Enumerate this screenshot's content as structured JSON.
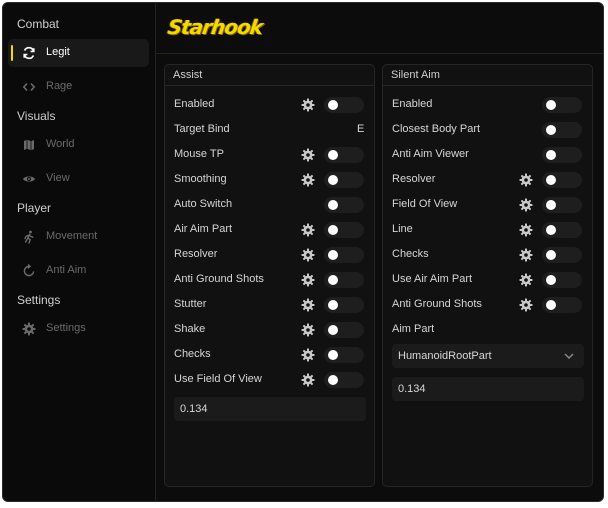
{
  "app": {
    "logo_text": "Starhook",
    "accent": "#f5d800"
  },
  "sidebar": {
    "sections": [
      {
        "title": "Combat"
      },
      {
        "title": "Visuals"
      },
      {
        "title": "Player"
      },
      {
        "title": "Settings"
      }
    ],
    "items": [
      {
        "label": "Legit",
        "icon": "refresh-icon",
        "active": true
      },
      {
        "label": "Rage",
        "icon": "code-icon",
        "active": false
      },
      {
        "label": "World",
        "icon": "map-icon",
        "active": false
      },
      {
        "label": "View",
        "icon": "eye-icon",
        "active": false
      },
      {
        "label": "Movement",
        "icon": "running-person-icon",
        "active": false
      },
      {
        "label": "Anti Aim",
        "icon": "rotate-icon",
        "active": false
      },
      {
        "label": "Settings",
        "icon": "gear-icon",
        "active": false
      }
    ]
  },
  "assist": {
    "title": "Assist",
    "rows": [
      {
        "label": "Enabled",
        "gear": true,
        "toggle": false
      },
      {
        "label": "Target Bind",
        "keybind": "E"
      },
      {
        "label": "Mouse TP",
        "gear": true,
        "toggle": false
      },
      {
        "label": "Smoothing",
        "gear": true,
        "toggle": false
      },
      {
        "label": "Auto Switch",
        "gear": false,
        "toggle": false
      },
      {
        "label": "Air Aim Part",
        "gear": true,
        "toggle": false
      },
      {
        "label": "Resolver",
        "gear": true,
        "toggle": false
      },
      {
        "label": "Anti Ground Shots",
        "gear": true,
        "toggle": false
      },
      {
        "label": "Stutter",
        "gear": true,
        "toggle": false
      },
      {
        "label": "Shake",
        "gear": true,
        "toggle": false
      },
      {
        "label": "Checks",
        "gear": true,
        "toggle": false
      },
      {
        "label": "Use Field Of View",
        "gear": true,
        "toggle": false
      }
    ],
    "value_field": "0.134"
  },
  "silent_aim": {
    "title": "Silent Aim",
    "rows": [
      {
        "label": "Enabled",
        "gear": false,
        "toggle": false
      },
      {
        "label": "Closest Body Part",
        "gear": false,
        "toggle": false
      },
      {
        "label": "Anti Aim Viewer",
        "gear": false,
        "toggle": false
      },
      {
        "label": "Resolver",
        "gear": true,
        "toggle": false
      },
      {
        "label": "Field Of View",
        "gear": true,
        "toggle": false
      },
      {
        "label": "Line",
        "gear": true,
        "toggle": false
      },
      {
        "label": "Checks",
        "gear": true,
        "toggle": false
      },
      {
        "label": "Use Air Aim Part",
        "gear": true,
        "toggle": false
      },
      {
        "label": "Anti Ground Shots",
        "gear": true,
        "toggle": false
      }
    ],
    "aim_part_label": "Aim Part",
    "aim_part_value": "HumanoidRootPart",
    "value_field": "0.134"
  }
}
